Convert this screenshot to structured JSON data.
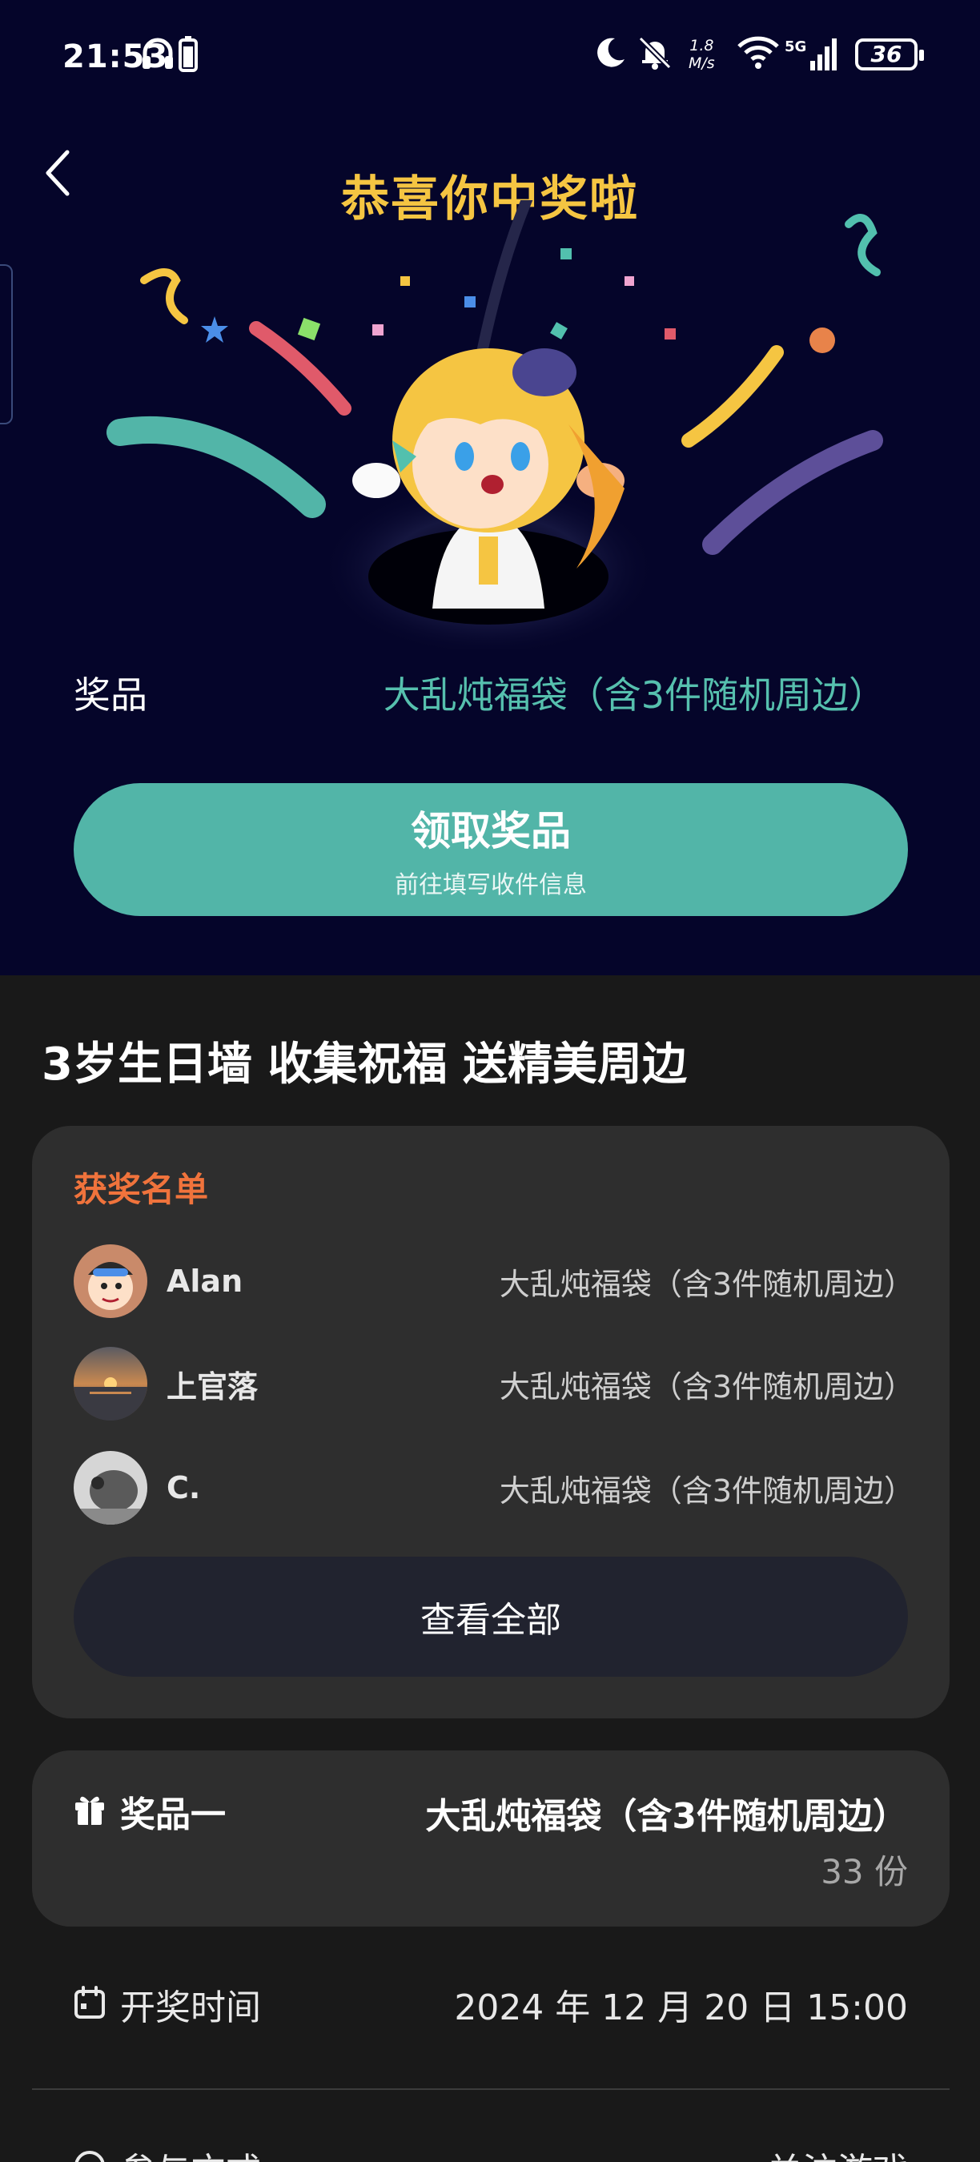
{
  "status_bar": {
    "time": "21:53",
    "net_speed_value": "1.8",
    "net_speed_unit": "M/s",
    "network": "5G",
    "battery": "36"
  },
  "hero": {
    "title": "恭喜你中奖啦",
    "prize_label": "奖品",
    "prize_value": "大乱炖福袋（含3件随机周边）",
    "claim_button": {
      "label": "领取奖品",
      "sublabel": "前往填写收件信息"
    }
  },
  "section_title": "3岁生日墙 收集祝福 送精美周边",
  "winners": {
    "heading": "获奖名单",
    "list": [
      {
        "name": "Alan",
        "prize": "大乱炖福袋（含3件随机周边）"
      },
      {
        "name": "上官落",
        "prize": "大乱炖福袋（含3件随机周边）"
      },
      {
        "name": "C.",
        "prize": "大乱炖福袋（含3件随机周边）"
      }
    ],
    "view_all": "查看全部"
  },
  "prize_card": {
    "tier_label": "奖品一",
    "name": "大乱炖福袋（含3件随机周边）",
    "count": "33 份"
  },
  "draw_time": {
    "label": "开奖时间",
    "value": "2024 年 12 月 20 日 15:00"
  },
  "participation": {
    "label": "参与方式",
    "value": "关注游戏"
  },
  "colors": {
    "hero_bg": "#05052a",
    "title_gold": "#f5c542",
    "accent_teal": "#52b5a8",
    "heading_orange": "#f0733c",
    "card_bg": "#2e2e2e",
    "page_bg": "#191919"
  }
}
